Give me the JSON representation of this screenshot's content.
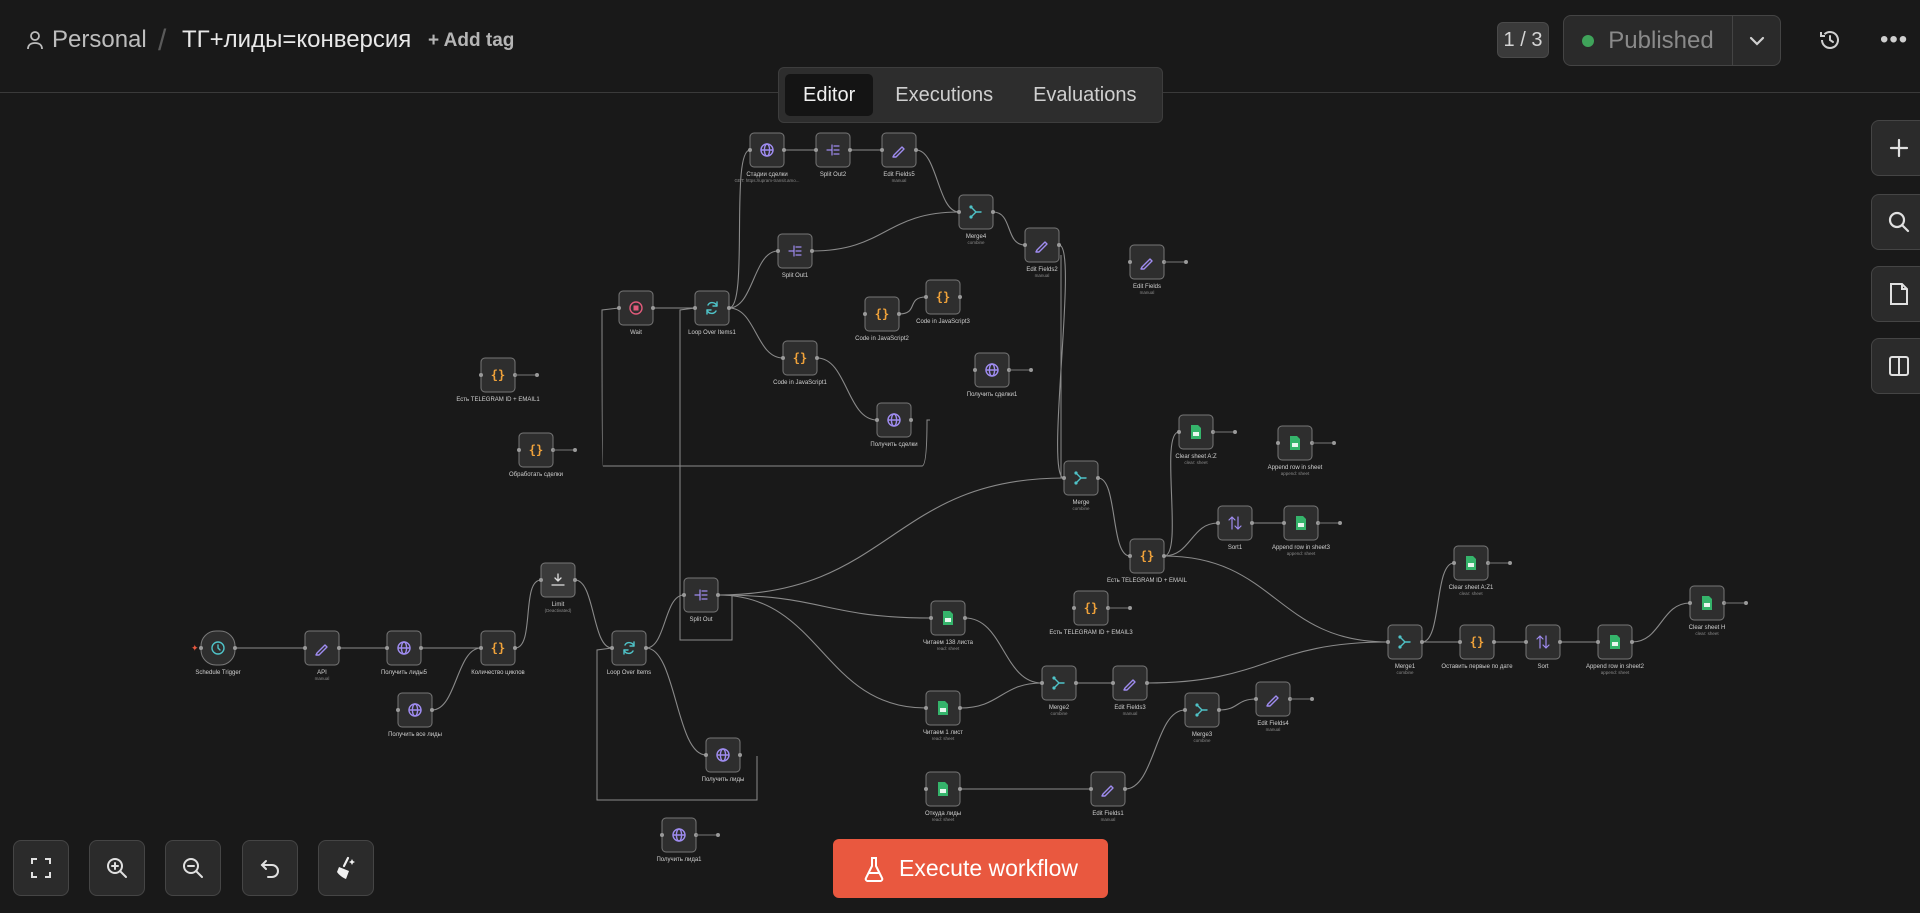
{
  "header": {
    "project": "Personal",
    "workflow_name": "ТГ+лиды=конверсия",
    "add_tag": "+ Add tag",
    "pager": "1 / 3",
    "publish_label": "Published"
  },
  "tabs": [
    {
      "label": "Editor",
      "active": true
    },
    {
      "label": "Executions",
      "active": false
    },
    {
      "label": "Evaluations",
      "active": false
    }
  ],
  "execute_button": "Execute workflow",
  "right_toolbar": [
    "plus-icon",
    "search-icon",
    "sticky-note-icon",
    "panel-icon"
  ],
  "bottom_toolbar": [
    "fit-view-icon",
    "zoom-in-icon",
    "zoom-out-icon",
    "undo-icon",
    "tidy-up-icon"
  ],
  "colors": {
    "background": "#191919",
    "accent": "#e9583f",
    "published_dot": "#3fa35a",
    "node_bg": "#2e2e2e",
    "icon_purple": "#9f8cf0",
    "icon_orange": "#f0a23a",
    "icon_green": "#35b46b",
    "icon_teal": "#4fc3c8",
    "icon_red": "#e05a7a"
  },
  "nodes": [
    {
      "id": "schedule",
      "label": "Schedule Trigger",
      "sub": "",
      "icon": "clock"
    },
    {
      "id": "api",
      "label": "API",
      "sub": "manual",
      "icon": "pencil"
    },
    {
      "id": "getleads5",
      "label": "Получить лиды5",
      "sub": "",
      "icon": "globe"
    },
    {
      "id": "cycles",
      "label": "Количество циклов",
      "sub": "",
      "icon": "code"
    },
    {
      "id": "getall",
      "label": "Получить все лиды",
      "sub": "",
      "icon": "globe"
    },
    {
      "id": "limit",
      "label": "Limit",
      "sub": "(Deactivated)",
      "icon": "limit"
    },
    {
      "id": "loop",
      "label": "Loop Over Items",
      "sub": "",
      "icon": "loop"
    },
    {
      "id": "splitout",
      "label": "Split Out",
      "sub": "",
      "icon": "split"
    },
    {
      "id": "getleads",
      "label": "Получить лиды",
      "sub": "",
      "icon": "globe"
    },
    {
      "id": "getleads1",
      "label": "Получить лида1",
      "sub": "",
      "icon": "globe"
    },
    {
      "id": "wait",
      "label": "Wait",
      "sub": "",
      "icon": "wait"
    },
    {
      "id": "loop1",
      "label": "Loop Over Items1",
      "sub": "",
      "icon": "loop"
    },
    {
      "id": "stages",
      "label": "Стадии сделки",
      "sub": "GET: https://upram-transit.amo...",
      "icon": "globe"
    },
    {
      "id": "split2",
      "label": "Split Out2",
      "sub": "",
      "icon": "split"
    },
    {
      "id": "ef5",
      "label": "Edit Fields5",
      "sub": "manual",
      "icon": "pencil"
    },
    {
      "id": "split1",
      "label": "Split Out1",
      "sub": "",
      "icon": "split"
    },
    {
      "id": "merge4",
      "label": "Merge4",
      "sub": "combine",
      "icon": "merge"
    },
    {
      "id": "ef2",
      "label": "Edit Fields2",
      "sub": "manual",
      "icon": "pencil"
    },
    {
      "id": "ef",
      "label": "Edit Fields",
      "sub": "manual",
      "icon": "pencil"
    },
    {
      "id": "js2",
      "label": "Code in JavaScript2",
      "sub": "",
      "icon": "code"
    },
    {
      "id": "js3",
      "label": "Code in JavaScript3",
      "sub": "",
      "icon": "code"
    },
    {
      "id": "js1",
      "label": "Code in JavaScript1",
      "sub": "",
      "icon": "code"
    },
    {
      "id": "deals1",
      "label": "Получить сделки1",
      "sub": "",
      "icon": "globe"
    },
    {
      "id": "deals",
      "label": "Получить сделки",
      "sub": "",
      "icon": "globe"
    },
    {
      "id": "tg1",
      "label": "Есть TELEGRAM ID + EMAIL1",
      "sub": "",
      "icon": "code"
    },
    {
      "id": "process",
      "label": "Обработать сделки",
      "sub": "",
      "icon": "code"
    },
    {
      "id": "merge",
      "label": "Merge",
      "sub": "combine",
      "icon": "merge"
    },
    {
      "id": "tgemail",
      "label": "Есть TELEGRAM ID + EMAIL",
      "sub": "",
      "icon": "code"
    },
    {
      "id": "clearaz",
      "label": "Clear sheet A:Z",
      "sub": "clear: sheet",
      "icon": "sheet"
    },
    {
      "id": "appendrow",
      "label": "Append row in sheet",
      "sub": "append: sheet",
      "icon": "sheet"
    },
    {
      "id": "sort1",
      "label": "Sort1",
      "sub": "",
      "icon": "sort"
    },
    {
      "id": "append3",
      "label": "Append row in sheet3",
      "sub": "append: sheet",
      "icon": "sheet"
    },
    {
      "id": "tg3",
      "label": "Есть TELEGRAM ID + EMAIL3",
      "sub": "",
      "icon": "code"
    },
    {
      "id": "read138",
      "label": "Читаем 138 листа",
      "sub": "read: sheet",
      "icon": "sheet"
    },
    {
      "id": "read1",
      "label": "Читаем 1 лист",
      "sub": "read: sheet",
      "icon": "sheet"
    },
    {
      "id": "merge2",
      "label": "Merge2",
      "sub": "combine",
      "icon": "merge"
    },
    {
      "id": "ef3",
      "label": "Edit Fields3",
      "sub": "manual",
      "icon": "pencil"
    },
    {
      "id": "merge3",
      "label": "Merge3",
      "sub": "combine",
      "icon": "merge"
    },
    {
      "id": "ef4",
      "label": "Edit Fields4",
      "sub": "manual",
      "icon": "pencil"
    },
    {
      "id": "fromleads",
      "label": "Откуда лиды",
      "sub": "read: sheet",
      "icon": "sheet"
    },
    {
      "id": "ef1",
      "label": "Edit Fields1",
      "sub": "manual",
      "icon": "pencil"
    },
    {
      "id": "merge1",
      "label": "Merge1",
      "sub": "combine",
      "icon": "merge"
    },
    {
      "id": "firstbydate",
      "label": "Оставить первые по дате",
      "sub": "",
      "icon": "code"
    },
    {
      "id": "sort",
      "label": "Sort",
      "sub": "",
      "icon": "sort"
    },
    {
      "id": "append2",
      "label": "Append row in sheet2",
      "sub": "append: sheet",
      "icon": "sheet"
    },
    {
      "id": "clearaz1",
      "label": "Clear sheet A:Z1",
      "sub": "clear: sheet",
      "icon": "sheet"
    },
    {
      "id": "clearh",
      "label": "Clear sheet H",
      "sub": "clear: sheet",
      "icon": "sheet"
    }
  ]
}
